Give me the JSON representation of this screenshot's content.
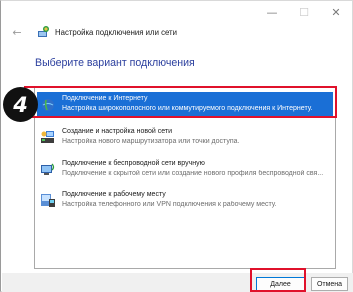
{
  "window": {
    "controls": {
      "minimize": "—",
      "maximize": "☐",
      "close": "✕"
    },
    "back_icon": "←",
    "header_title": "Настройка подключения или сети"
  },
  "page_title": "Выберите вариант подключения",
  "options": [
    {
      "title": "Подключение к Интернету",
      "description": "Настройка широкополосного или коммутируемого подключения к Интернету.",
      "icon": "globe-icon",
      "selected": true
    },
    {
      "title": "Создание и настройка новой сети",
      "description": "Настройка нового маршрутизатора или точки доступа.",
      "icon": "network-router-icon",
      "selected": false
    },
    {
      "title": "Подключение к беспроводной сети вручную",
      "description": "Подключение к скрытой сети или создание нового профиля беспроводной свя...",
      "icon": "wireless-computer-icon",
      "selected": false
    },
    {
      "title": "Подключение к рабочему месту",
      "description": "Настройка телефонного или VPN подключения к рабочему месту.",
      "icon": "workplace-phone-icon",
      "selected": false
    }
  ],
  "annotation": {
    "step_number": "4"
  },
  "buttons": {
    "next": "Далее",
    "cancel": "Отмена"
  },
  "colors": {
    "selection": "#1a6fd6",
    "highlight_frame": "#e0112b",
    "title_blue": "#2b3f9e"
  }
}
